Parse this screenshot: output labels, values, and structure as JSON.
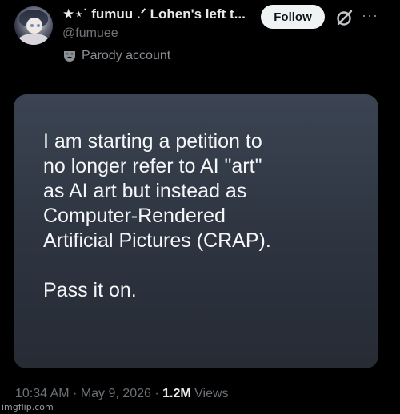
{
  "post": {
    "author_name": "★⋆˙ fumuu .ᐟ Lohen's left t...",
    "handle": "@fumuee",
    "follow_label": "Follow",
    "more_glyph": "···",
    "parody_label": "Parody account",
    "card": {
      "lines": [
        "I am starting a petition to",
        "no longer refer to AI \"art\"",
        "as AI art but instead as",
        "Computer-Rendered",
        "Artificial Pictures (CRAP)."
      ],
      "closing": "Pass it on."
    },
    "meta": {
      "time": "10:34 AM",
      "sep1": " · ",
      "date": "May 9, 2026",
      "sep2": " · ",
      "views_count": "1.2M",
      "views_label": " Views"
    }
  },
  "watermark": "imgflip.com",
  "icons": {
    "avatar": "avatar",
    "grok": "grok-icon",
    "more": "more-icon",
    "parody": "mask-icon"
  },
  "colors": {
    "background": "#000000",
    "primary_text": "#e7e9ea",
    "secondary_text": "#71767b",
    "follow_bg": "#eff3f4",
    "card_bg": "#2d3440"
  }
}
